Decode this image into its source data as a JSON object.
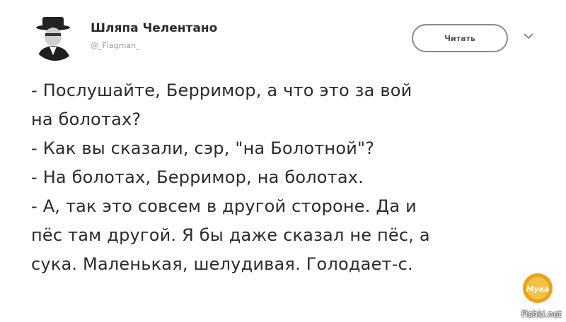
{
  "author": {
    "name": "Шляпа Челентано",
    "handle": "@_Flagman_"
  },
  "follow_button": {
    "label": "Читать"
  },
  "tweet": {
    "lines": [
      "- Послушайте, Берримор, а что это за вой",
      "на болотах?",
      "- Как вы сказали, сэр, \"на Болотной\"?",
      "- На болотах, Берримор, на болотах.",
      "- А, так это совсем в другой стороне. Да и",
      "пёс там другой. Я бы даже сказал не пёс, а",
      "сука. Маленькая, шелудивая. Голодает-с."
    ]
  },
  "channel_logo": {
    "text": "Мука",
    "color": "#e8a317"
  },
  "watermark": {
    "text": "Fishki.net"
  }
}
